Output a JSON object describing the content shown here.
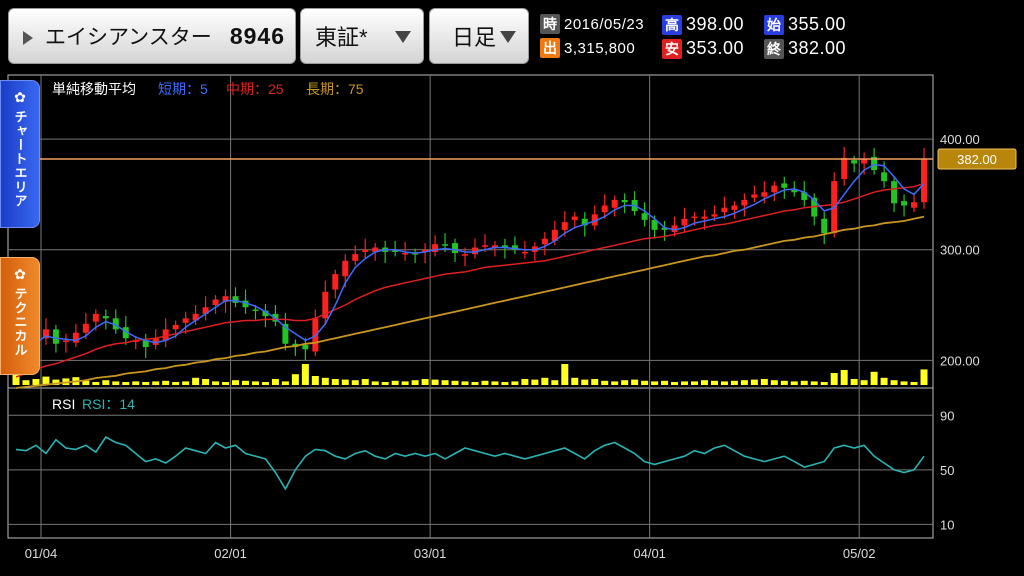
{
  "header": {
    "stock_name": "エイシアンスター",
    "stock_code": "8946",
    "market": "東証*",
    "period": "日足"
  },
  "quote": {
    "time_label": "時",
    "date": "2016/05/23",
    "high_label": "高",
    "high": "398.00",
    "open_label": "始",
    "open": "355.00",
    "volume_label": "出",
    "volume": "3,315,800",
    "low_label": "安",
    "low": "353.00",
    "close_label": "終",
    "close": "382.00"
  },
  "colors": {
    "up": "#ff2020",
    "down": "#22c322",
    "ma_short": "#3b6cff",
    "ma_mid": "#e02020",
    "ma_long": "#c8961e",
    "rsi": "#2bb3b3",
    "volume": "#ffff20",
    "price_line": "#f0a060",
    "badge_time": "#555555",
    "badge_high": "#2a3ee0",
    "badge_low": "#e02020",
    "badge_open": "#2a3ee0",
    "badge_volume": "#f07810",
    "badge_close": "#555555"
  },
  "side_tabs": {
    "chart_area": "チャートエリア",
    "technical": "テクニカル"
  },
  "legend": {
    "sma_title": "単純移動平均",
    "short": "短期：5",
    "mid": "中期：25",
    "long": "長期：75",
    "rsi_title": "RSI",
    "rsi_param": "RSI：14"
  },
  "current_price_label": "382.00",
  "chart_data": {
    "type": "candlestick",
    "price_ticks": [
      "400.00",
      "300.00",
      "200.00"
    ],
    "price_tick_values": [
      400,
      300,
      200
    ],
    "ylim": [
      175,
      458
    ],
    "rsi_ticks": [
      "90",
      "50",
      "10"
    ],
    "rsi_tick_values": [
      90,
      50,
      10
    ],
    "rsi_ylim": [
      0,
      110
    ],
    "x_labels": [
      "01/04",
      "02/01",
      "03/01",
      "04/01",
      "05/02"
    ],
    "x_label_index": [
      0,
      19,
      39,
      61,
      82
    ],
    "current_price": 382,
    "close": [
      205,
      212,
      222,
      228,
      215,
      218,
      225,
      233,
      242,
      238,
      228,
      220,
      218,
      212,
      220,
      228,
      232,
      238,
      242,
      248,
      255,
      258,
      252,
      248,
      245,
      240,
      235,
      215,
      212,
      210,
      238,
      262,
      278,
      290,
      296,
      300,
      302,
      298,
      298,
      297,
      296,
      300,
      305,
      304,
      297,
      296,
      302,
      304,
      304,
      302,
      300,
      298,
      303,
      310,
      318,
      325,
      330,
      322,
      332,
      340,
      345,
      343,
      335,
      327,
      318,
      318,
      322,
      328,
      330,
      330,
      332,
      338,
      340,
      345,
      350,
      352,
      358,
      356,
      352,
      345,
      330,
      315,
      362,
      383,
      378,
      382,
      372,
      362,
      342,
      340,
      343,
      382
    ],
    "ma5": [
      202,
      208,
      216,
      222,
      220,
      219,
      218,
      222,
      230,
      235,
      232,
      226,
      221,
      218,
      216,
      218,
      222,
      230,
      236,
      242,
      248,
      254,
      254,
      252,
      249,
      244,
      238,
      230,
      224,
      218,
      222,
      233,
      250,
      270,
      284,
      292,
      298,
      300,
      300,
      298,
      297,
      298,
      300,
      301,
      300,
      298,
      298,
      300,
      302,
      302,
      301,
      300,
      300,
      303,
      308,
      315,
      320,
      323,
      326,
      330,
      336,
      340,
      340,
      335,
      328,
      320,
      318,
      320,
      324,
      326,
      328,
      330,
      333,
      337,
      341,
      346,
      350,
      354,
      355,
      352,
      345,
      335,
      338,
      350,
      362,
      372,
      377,
      376,
      366,
      355,
      350,
      360
    ],
    "ma25": [
      185,
      188,
      192,
      195,
      197,
      200,
      203,
      206,
      210,
      213,
      215,
      216,
      218,
      219,
      220,
      222,
      224,
      226,
      228,
      230,
      232,
      234,
      235,
      236,
      236,
      237,
      237,
      237,
      236,
      236,
      238,
      242,
      246,
      250,
      255,
      259,
      263,
      266,
      268,
      270,
      272,
      274,
      276,
      278,
      279,
      280,
      282,
      284,
      285,
      286,
      287,
      288,
      289,
      290,
      292,
      294,
      296,
      298,
      300,
      302,
      304,
      306,
      308,
      310,
      311,
      312,
      314,
      316,
      318,
      320,
      322,
      323,
      325,
      327,
      329,
      331,
      333,
      335,
      336,
      338,
      339,
      340,
      341,
      343,
      346,
      349,
      352,
      354,
      355,
      356,
      357,
      360
    ],
    "ma75": [
      175,
      176,
      177,
      178,
      179,
      180,
      181,
      182,
      184,
      185,
      186,
      188,
      189,
      190,
      192,
      193,
      195,
      196,
      198,
      199,
      201,
      202,
      204,
      205,
      207,
      208,
      210,
      212,
      213,
      215,
      216,
      218,
      220,
      222,
      224,
      226,
      228,
      230,
      232,
      234,
      236,
      238,
      240,
      242,
      244,
      246,
      248,
      250,
      252,
      254,
      256,
      258,
      260,
      262,
      264,
      266,
      268,
      270,
      272,
      274,
      276,
      278,
      280,
      282,
      284,
      286,
      288,
      290,
      292,
      294,
      295,
      297,
      299,
      300,
      302,
      304,
      306,
      308,
      309,
      311,
      312,
      314,
      316,
      318,
      319,
      321,
      322,
      324,
      325,
      326,
      328,
      330
    ],
    "volume": [
      0.35,
      0.08,
      0.1,
      0.14,
      0.09,
      0.11,
      0.13,
      0.07,
      0.05,
      0.08,
      0.06,
      0.05,
      0.06,
      0.05,
      0.06,
      0.07,
      0.05,
      0.06,
      0.12,
      0.1,
      0.06,
      0.05,
      0.08,
      0.07,
      0.06,
      0.05,
      0.1,
      0.06,
      0.18,
      0.35,
      0.15,
      0.12,
      0.1,
      0.09,
      0.08,
      0.1,
      0.06,
      0.05,
      0.07,
      0.06,
      0.08,
      0.1,
      0.09,
      0.08,
      0.07,
      0.06,
      0.05,
      0.07,
      0.06,
      0.05,
      0.06,
      0.1,
      0.09,
      0.12,
      0.08,
      0.35,
      0.12,
      0.09,
      0.1,
      0.07,
      0.06,
      0.08,
      0.09,
      0.07,
      0.06,
      0.07,
      0.05,
      0.06,
      0.06,
      0.08,
      0.07,
      0.06,
      0.07,
      0.08,
      0.09,
      0.1,
      0.08,
      0.07,
      0.06,
      0.07,
      0.06,
      0.05,
      0.2,
      0.25,
      0.1,
      0.08,
      0.22,
      0.12,
      0.08,
      0.06,
      0.05,
      0.26
    ],
    "rsi": [
      65,
      64,
      68,
      62,
      72,
      66,
      65,
      68,
      63,
      74,
      70,
      68,
      62,
      56,
      58,
      55,
      60,
      66,
      64,
      62,
      70,
      66,
      68,
      62,
      60,
      58,
      48,
      36,
      50,
      60,
      65,
      64,
      60,
      58,
      62,
      64,
      60,
      58,
      62,
      60,
      62,
      60,
      62,
      58,
      62,
      66,
      64,
      62,
      60,
      62,
      60,
      58,
      60,
      62,
      64,
      66,
      62,
      58,
      64,
      68,
      70,
      66,
      62,
      56,
      54,
      56,
      58,
      60,
      64,
      62,
      66,
      68,
      64,
      60,
      58,
      56,
      58,
      60,
      56,
      52,
      54,
      56,
      66,
      68,
      66,
      68,
      60,
      55,
      50,
      48,
      50,
      60
    ]
  }
}
